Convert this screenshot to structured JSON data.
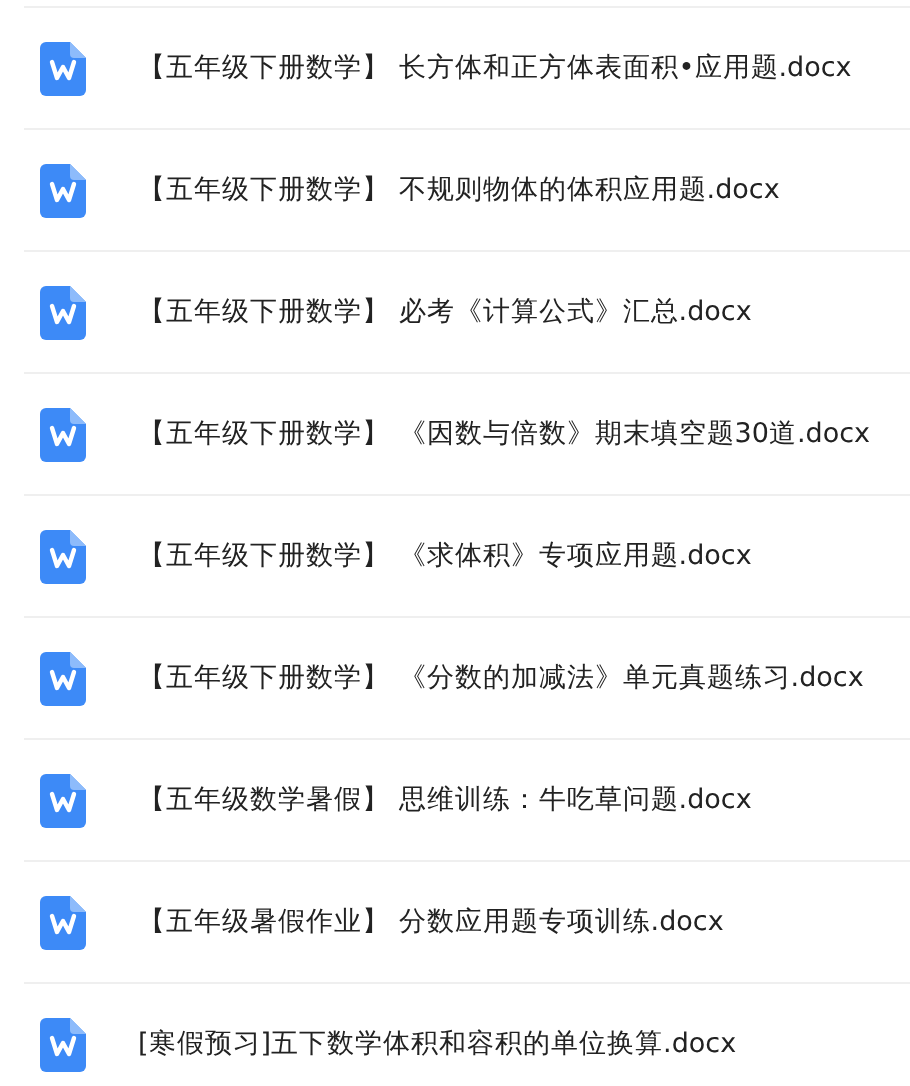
{
  "files": [
    {
      "name": "【五年级下册数学】 长方体和正方体表面积•应用题.docx"
    },
    {
      "name": "【五年级下册数学】 不规则物体的体积应用题.docx"
    },
    {
      "name": "【五年级下册数学】 必考《计算公式》汇总.docx"
    },
    {
      "name": "【五年级下册数学】 《因数与倍数》期末填空题30道.docx"
    },
    {
      "name": "【五年级下册数学】 《求体积》专项应用题.docx"
    },
    {
      "name": "【五年级下册数学】 《分数的加减法》单元真题练习.docx"
    },
    {
      "name": "【五年级数学暑假】 思维训练：牛吃草问题.docx"
    },
    {
      "name": "【五年级暑假作业】 分数应用题专项训练.docx"
    },
    {
      "name": "[寒假预习]五下数学体积和容积的单位换算.docx"
    }
  ]
}
